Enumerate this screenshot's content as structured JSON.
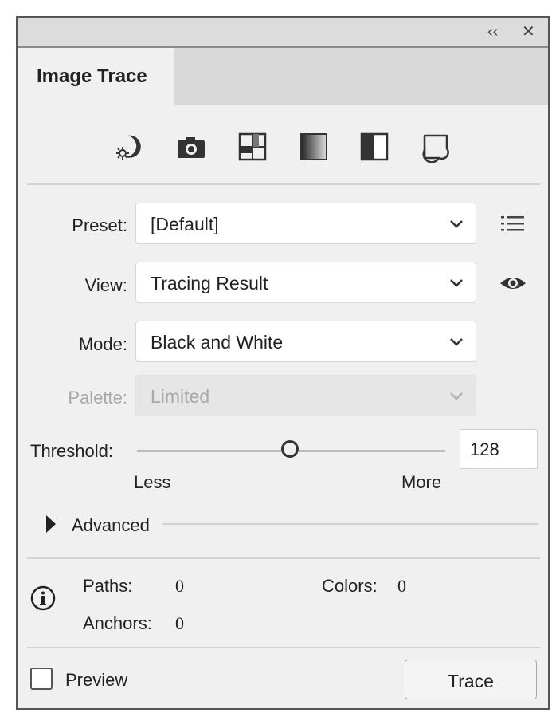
{
  "window": {
    "collapse_glyph": "‹‹",
    "close_glyph": "✕"
  },
  "tab": {
    "label": "Image Trace"
  },
  "preset_buttons": [
    {
      "icon": "auto-color-icon"
    },
    {
      "icon": "camera-icon"
    },
    {
      "icon": "low-color-icon"
    },
    {
      "icon": "grayscale-icon"
    },
    {
      "icon": "black-white-icon"
    },
    {
      "icon": "outline-icon"
    }
  ],
  "fields": {
    "preset": {
      "label": "Preset:",
      "value": "[Default]",
      "side_icon": "list-menu-icon"
    },
    "view": {
      "label": "View:",
      "value": "Tracing Result",
      "side_icon": "eye-icon"
    },
    "mode": {
      "label": "Mode:",
      "value": "Black and White"
    },
    "palette": {
      "label": "Palette:",
      "value": "Limited",
      "disabled": true
    }
  },
  "threshold": {
    "label": "Threshold:",
    "value": "128",
    "min_label": "Less",
    "max_label": "More",
    "range": [
      1,
      255
    ],
    "current": 128
  },
  "advanced": {
    "label": "Advanced",
    "expanded": false
  },
  "stats": {
    "paths_label": "Paths:",
    "paths_value": "0",
    "colors_label": "Colors:",
    "colors_value": "0",
    "anchors_label": "Anchors:",
    "anchors_value": "0"
  },
  "footer": {
    "preview_label": "Preview",
    "preview_checked": false,
    "trace_label": "Trace"
  },
  "colors": {
    "panel_bg": "#f0f0f0",
    "tabbar_bg": "#d9d9d9",
    "disabled_text": "#a8a8a8"
  }
}
